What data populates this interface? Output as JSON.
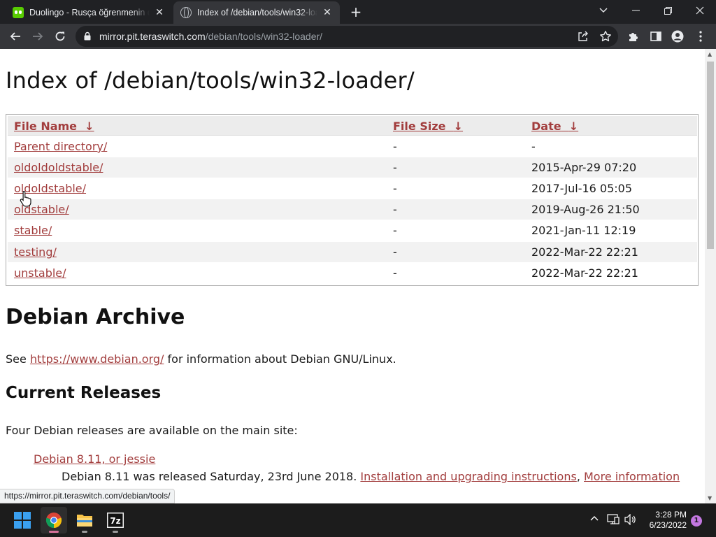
{
  "browser": {
    "tabs": [
      {
        "title": "Duolingo - Rusça öğrenmenin dü",
        "icon": "duolingo-icon",
        "active": false
      },
      {
        "title": "Index of /debian/tools/win32-loa",
        "icon": "globe-icon",
        "active": true
      }
    ],
    "url_host": "mirror.pit.teraswitch.com",
    "url_path": "/debian/tools/win32-loader/"
  },
  "page": {
    "title": "Index of /debian/tools/win32-loader/",
    "columns": [
      {
        "label": "File Name",
        "arrow": "↓"
      },
      {
        "label": "File Size",
        "arrow": "↓"
      },
      {
        "label": "Date",
        "arrow": "↓"
      }
    ],
    "rows": [
      {
        "name": "Parent directory/",
        "size": "-",
        "date": "-"
      },
      {
        "name": "oldoldoldstable/",
        "size": "-",
        "date": "2015-Apr-29 07:20"
      },
      {
        "name": "oldoldstable/",
        "size": "-",
        "date": "2017-Jul-16 05:05"
      },
      {
        "name": "oldstable/",
        "size": "-",
        "date": "2019-Aug-26 21:50"
      },
      {
        "name": "stable/",
        "size": "-",
        "date": "2021-Jan-11 12:19"
      },
      {
        "name": "testing/",
        "size": "-",
        "date": "2022-Mar-22 22:21"
      },
      {
        "name": "unstable/",
        "size": "-",
        "date": "2022-Mar-22 22:21"
      }
    ],
    "archive_heading": "Debian Archive",
    "see_prefix": "See ",
    "see_link": "https://www.debian.org/",
    "see_suffix": " for information about Debian GNU/Linux.",
    "releases_heading": "Current Releases",
    "releases_intro": "Four Debian releases are available on the main site:",
    "release_link": "Debian 8.11, or jessie",
    "release_text": "Debian 8.11 was released Saturday, 23rd June 2018.",
    "install_link": "Installation and upgrading instructions",
    "comma": ",",
    "more_link": "More information"
  },
  "status_url": "https://mirror.pit.teraswitch.com/debian/tools/",
  "taskbar": {
    "time": "3:28 PM",
    "date": "6/23/2022",
    "notifications": "1"
  },
  "colors": {
    "link": "#a23d3d",
    "chrome_dark": "#202124",
    "chrome_toolbar": "#35363a"
  }
}
